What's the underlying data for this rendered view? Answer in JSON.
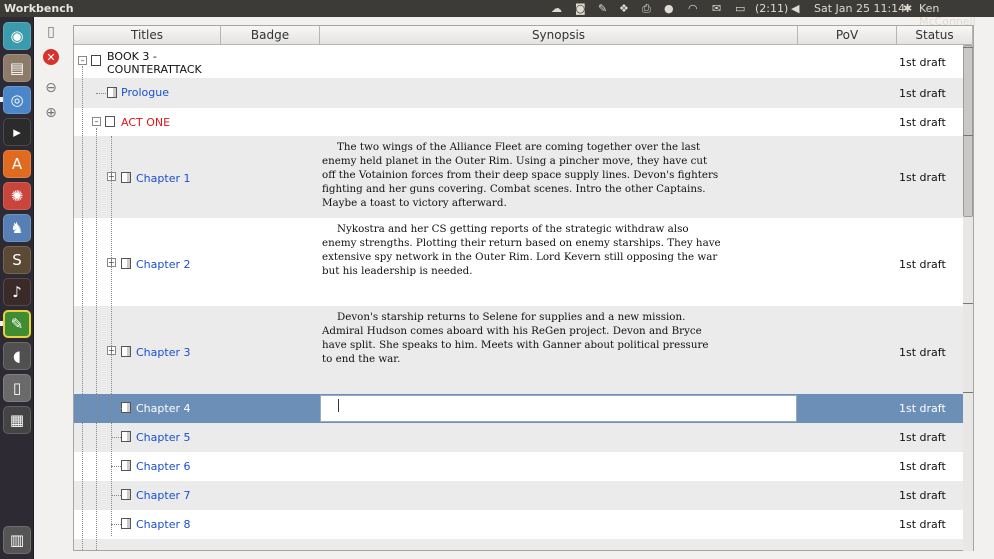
{
  "topbar": {
    "app_title": "Workbench",
    "battery_time": "(2:11)",
    "datetime": "Sat Jan 25  11:14",
    "user": "Ken McConnell"
  },
  "launcher": {
    "apps": [
      "dash-home",
      "files",
      "chromium",
      "terminal",
      "software-center",
      "system-settings",
      "bluefish",
      "scrivener",
      "rhythm",
      "workbench",
      "mouse",
      "reader",
      "workspace-switcher",
      "trash"
    ]
  },
  "columns": {
    "titles": "Titles",
    "badge": "Badge",
    "synopsis": "Synopsis",
    "pov": "PoV",
    "status": "Status"
  },
  "rows": [
    {
      "title_line1": "BOOK 3 -",
      "title_line2": "COUNTERATTACK",
      "status": "1st draft"
    },
    {
      "title": "Prologue",
      "status": "1st draft"
    },
    {
      "title": "ACT ONE",
      "status": "1st draft"
    },
    {
      "title": "Chapter 1",
      "synopsis": "The two wings of the Alliance Fleet are coming together over the last enemy held planet in the Outer Rim. Using a pincher move, they have cut off the Votainion forces from their deep space supply lines. Devon's fighters fighting and her guns covering. Combat scenes. Intro the other Captains. Maybe a toast to victory afterward.",
      "status": "1st draft"
    },
    {
      "title": "Chapter 2",
      "synopsis": "Nykostra and her CS getting reports of the strategic withdraw also enemy strengths. Plotting their return based on enemy starships. They have extensive spy network in the Outer Rim. Lord Kevern still opposing the war but his leadership is needed.",
      "status": "1st draft"
    },
    {
      "title": "Chapter 3",
      "synopsis": "Devon's starship returns to Selene for supplies and a new mission. Admiral Hudson comes aboard with his ReGen project. Devon and Bryce have split. She speaks to him. Meets with Ganner about political pressure to end the war.",
      "status": "1st draft"
    },
    {
      "title": "Chapter 4",
      "status": "1st draft"
    },
    {
      "title": "Chapter 5",
      "status": "1st draft"
    },
    {
      "title": "Chapter 6",
      "status": "1st draft"
    },
    {
      "title": "Chapter 7",
      "status": "1st draft"
    },
    {
      "title": "Chapter 8",
      "status": "1st draft"
    }
  ],
  "colors": {
    "selection": "#6c8fb8",
    "link": "#1a4fd0",
    "act": "#e21616",
    "panel": "#3c3b37",
    "launcher": "#2e2a33"
  }
}
